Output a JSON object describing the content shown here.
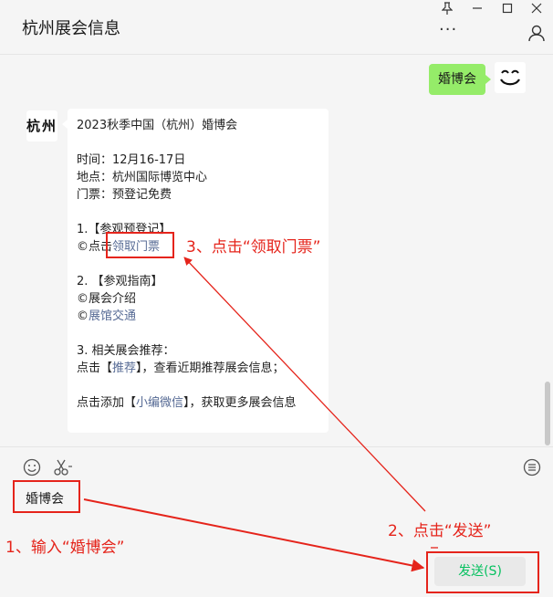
{
  "window": {
    "title": "杭州展会信息",
    "more_label": "···"
  },
  "chat": {
    "my_message": "婚博会",
    "bot_avatar_text": "杭州",
    "bot_message": {
      "line1": "2023秋季中国（杭州）婚博会",
      "time": "时间：12月16-17日",
      "place": "地点：杭州国际博览中心",
      "ticket": "门票：预登记免费",
      "sec1_title": "1.【参观预登记】",
      "sec1_prefix": "©点击",
      "sec1_link": "领取门票",
      "sec2_title": "2. 【参观指南】",
      "sec2_item1": "©展会介绍",
      "sec2_item2_prefix": "©",
      "sec2_item2_link": "展馆交通",
      "sec3_title": "3. 相关展会推荐：",
      "sec3_prefix": "点击【",
      "sec3_link": "推荐",
      "sec3_suffix": "】，查看近期推荐展会信息；",
      "sec4_prefix": "点击添加【",
      "sec4_link": "小编微信",
      "sec4_suffix": "】，获取更多展会信息"
    }
  },
  "input": {
    "typed_text": "婚博会",
    "send_label": "发送(S)"
  },
  "annotations": {
    "step1": "1、输入“婚博会”",
    "step2": "2、点击“发送”",
    "step3": "3、点击“领取门票”"
  },
  "colors": {
    "annotation_red": "#e5241b",
    "my_bubble_green": "#95ec69",
    "link_blue": "#576b95",
    "send_text_green": "#07c160"
  }
}
